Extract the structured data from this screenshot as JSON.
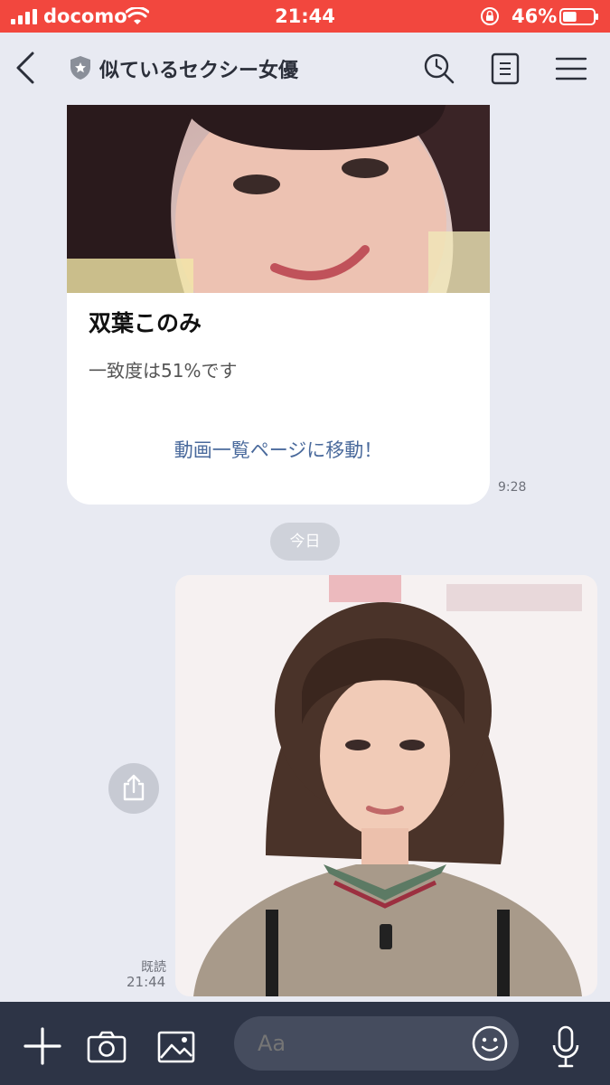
{
  "status_bar": {
    "carrier": "docomo",
    "time": "21:44",
    "battery": "46%",
    "battery_level": 0.46
  },
  "header": {
    "title": "似ているセクシー女優",
    "icons": [
      "back-icon",
      "shield-star-icon",
      "search-history-icon",
      "notes-icon",
      "menu-icon"
    ]
  },
  "messages": {
    "card": {
      "name": "双葉このみ",
      "score": "一致度は51%です",
      "link": "動画一覧ページに移動！",
      "time": "9:28"
    },
    "date_divider": "今日",
    "photo_message": {
      "read_label": "既読",
      "time": "21:44"
    }
  },
  "input_bar": {
    "placeholder": "Aa",
    "icons": [
      "plus-icon",
      "camera-icon",
      "image-icon",
      "smile-icon",
      "mic-icon"
    ]
  },
  "colors": {
    "status_bar": "#f2473e",
    "chat_background": "#e8eaf2",
    "bottom_bar": "#2d3446",
    "link": "#4a6a9c"
  }
}
